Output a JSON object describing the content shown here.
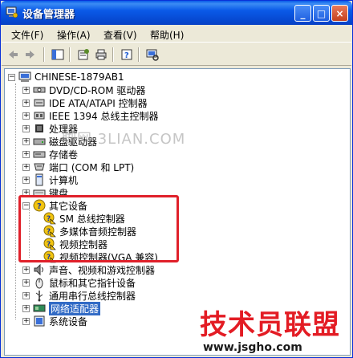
{
  "window": {
    "title": "设备管理器"
  },
  "titlebar_buttons": [
    "_",
    "□",
    "×"
  ],
  "menu": [
    "文件(F)",
    "操作(A)",
    "查看(V)",
    "帮助(H)"
  ],
  "toolbar_icons": [
    "back-arrow-icon",
    "forward-arrow-icon",
    "console-tree-icon",
    "properties-icon",
    "print-icon",
    "help-icon",
    "scan-hardware-icon"
  ],
  "tree": {
    "root": "CHINESE-1879AB1",
    "categories": [
      {
        "label": "DVD/CD-ROM 驱动器",
        "expanded": false
      },
      {
        "label": "IDE ATA/ATAPI 控制器",
        "expanded": false
      },
      {
        "label": "IEEE 1394 总线主控制器",
        "expanded": false
      },
      {
        "label": "处理器",
        "expanded": false
      },
      {
        "label": "磁盘驱动器",
        "expanded": false
      },
      {
        "label": "存储卷",
        "expanded": false
      },
      {
        "label": "端口 (COM 和 LPT)",
        "expanded": false
      },
      {
        "label": "计算机",
        "expanded": false
      },
      {
        "label": "键盘",
        "expanded": false
      },
      {
        "label": "其它设备",
        "expanded": true,
        "children": [
          "SM 总线控制器",
          "多媒体音频控制器",
          "视频控制器",
          "视频控制器(VGA 兼容)"
        ]
      },
      {
        "label": "声音、视频和游戏控制器",
        "expanded": false
      },
      {
        "label": "鼠标和其它指针设备",
        "expanded": false
      },
      {
        "label": "通用串行总线控制器",
        "expanded": false
      },
      {
        "label": "网络适配器",
        "expanded": false,
        "selected": true
      },
      {
        "label": "系统设备",
        "expanded": false
      }
    ]
  },
  "watermarks": {
    "middle": "脚网 3LIAN.COM",
    "brand": "技术员联盟",
    "url": "www.jsgho.com"
  },
  "colors": {
    "title_blue": "#0a5ae8",
    "selection": "#316ac5",
    "highlight_red": "#e0202a"
  }
}
